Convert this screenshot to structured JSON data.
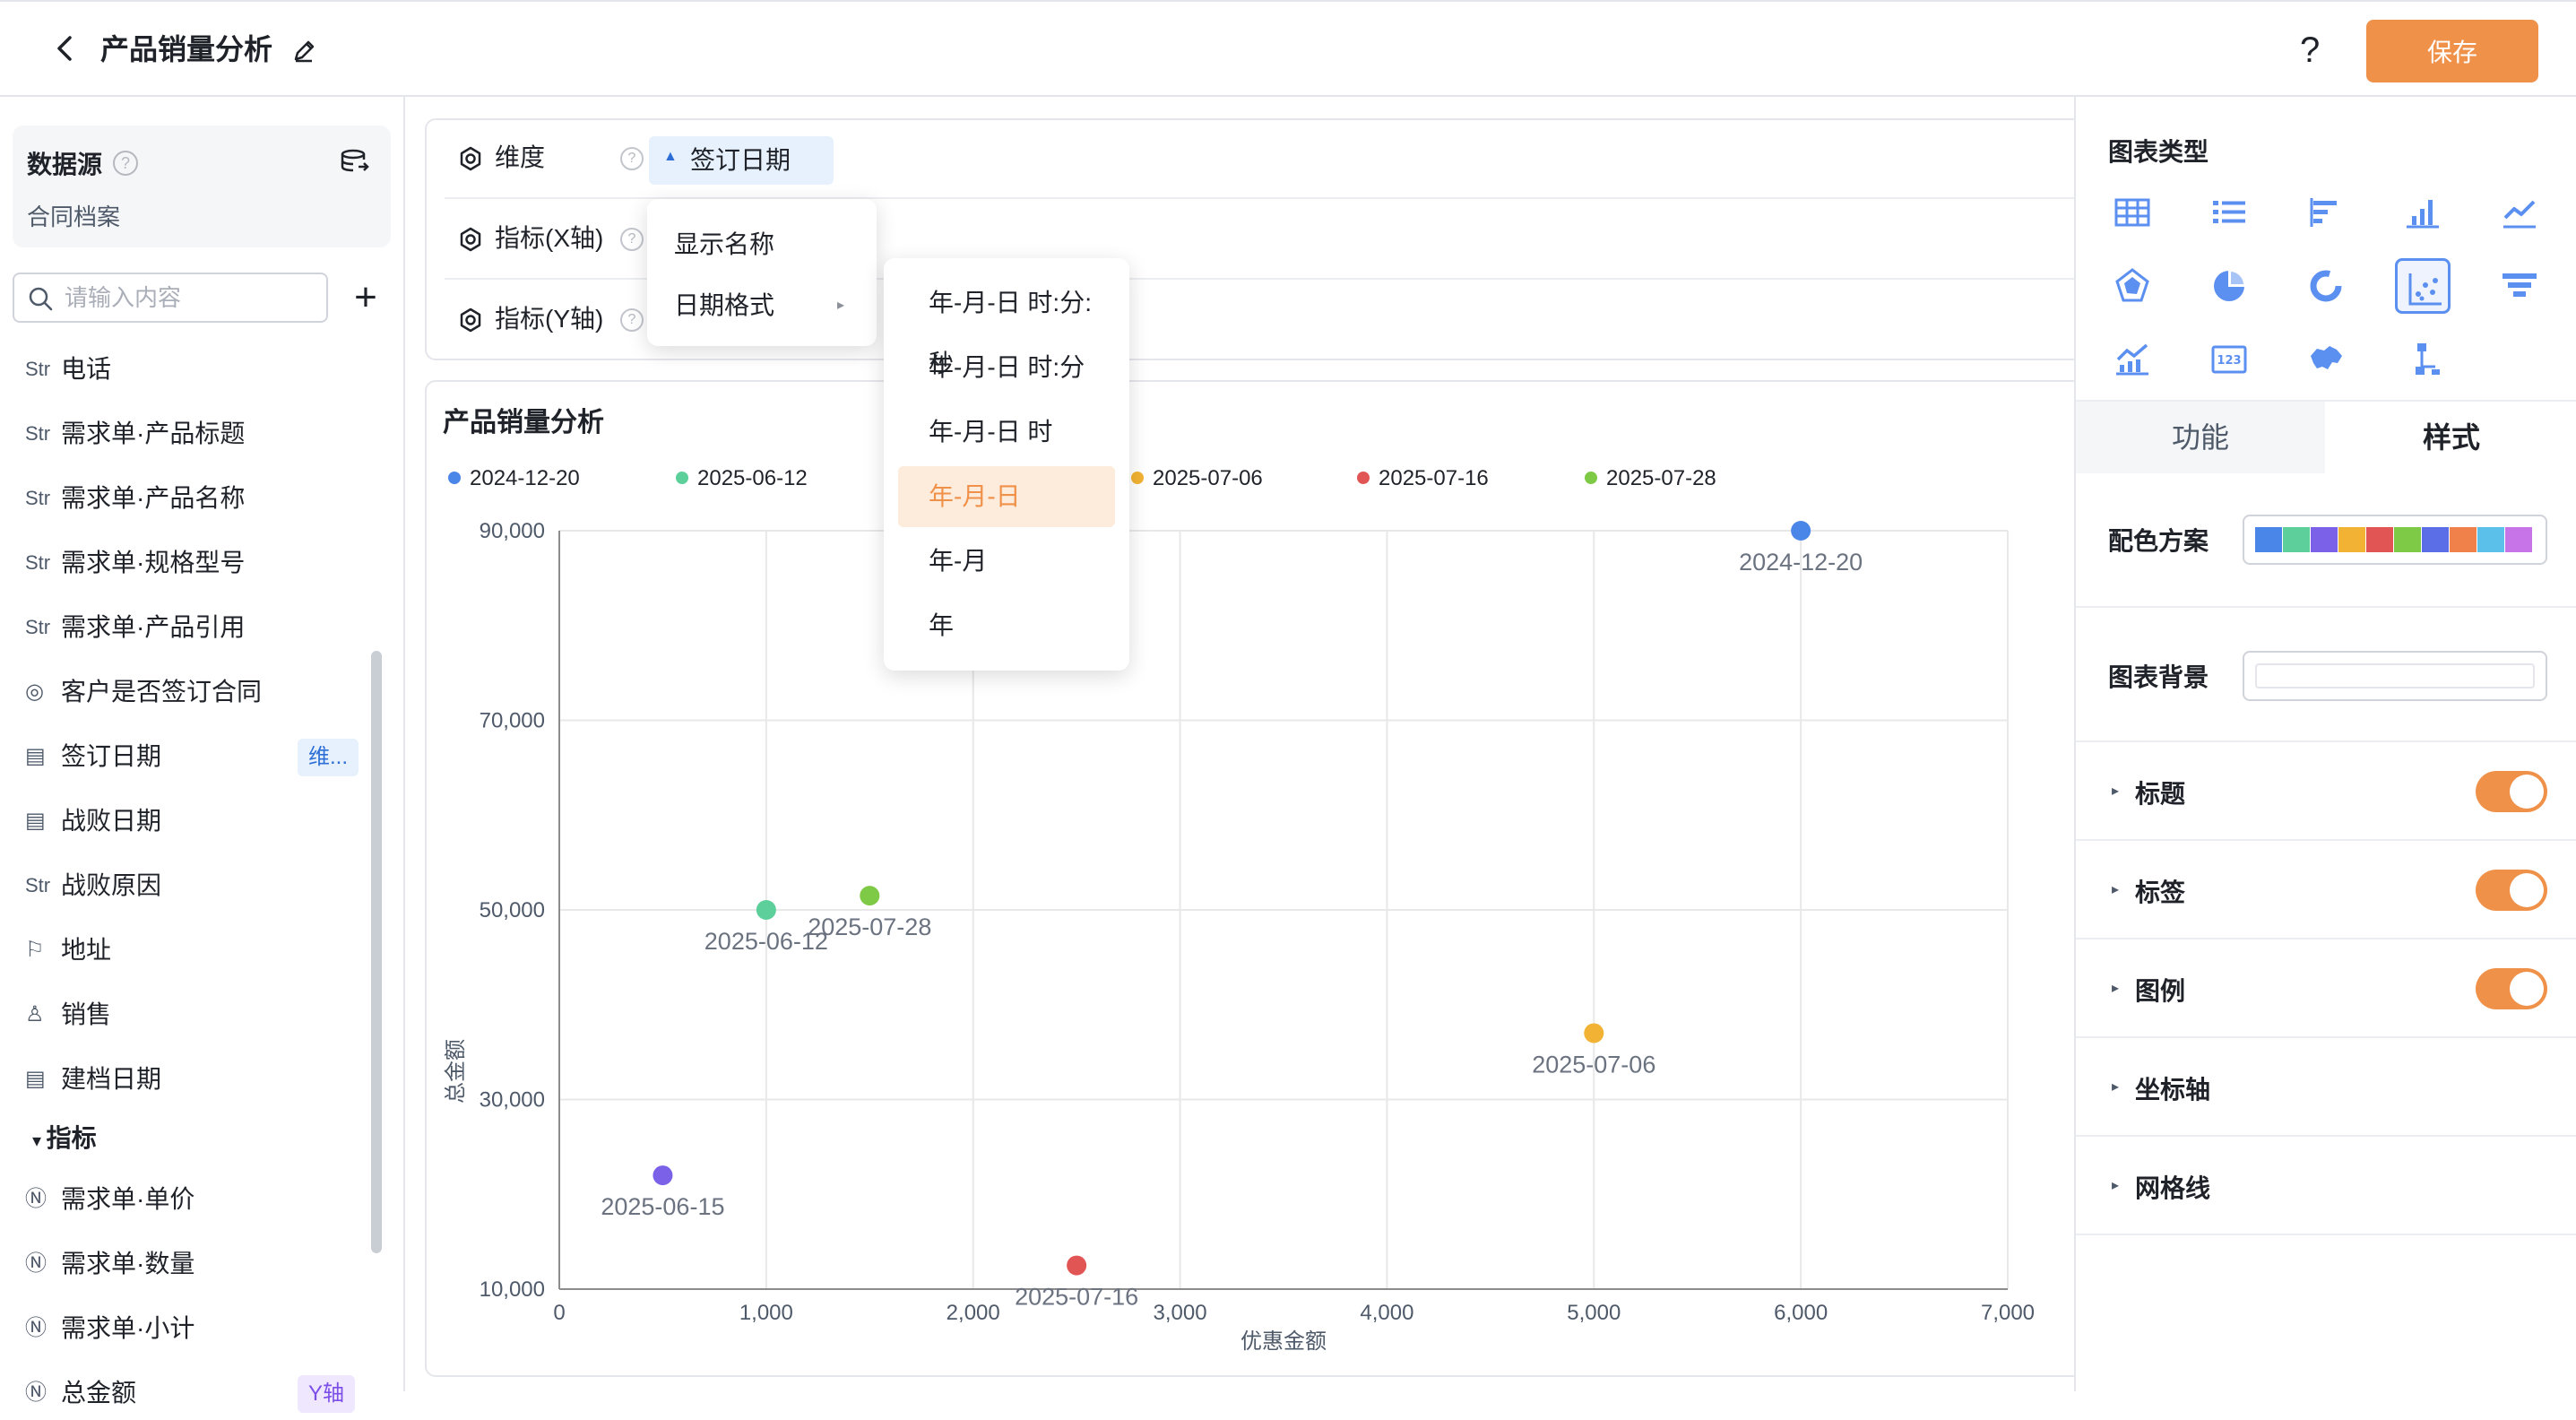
{
  "header": {
    "title": "产品销量分析",
    "help_label": "?",
    "save_label": "保存"
  },
  "datasource": {
    "label": "数据源",
    "help": "?",
    "name": "合同档案"
  },
  "search": {
    "placeholder": "请输入内容",
    "add_label": "+"
  },
  "fields": [
    {
      "type": "Str",
      "label": "电话"
    },
    {
      "type": "Str",
      "label": "需求单·产品标题"
    },
    {
      "type": "Str",
      "label": "需求单·产品名称"
    },
    {
      "type": "Str",
      "label": "需求单·规格型号"
    },
    {
      "type": "Str",
      "label": "需求单·产品引用"
    },
    {
      "type": "radio",
      "label": "客户是否签订合同"
    },
    {
      "type": "date",
      "label": "签订日期",
      "badge": "维..."
    },
    {
      "type": "date",
      "label": "战败日期"
    },
    {
      "type": "Str",
      "label": "战败原因"
    },
    {
      "type": "address",
      "label": "地址"
    },
    {
      "type": "user",
      "label": "销售"
    },
    {
      "type": "date",
      "label": "建档日期"
    }
  ],
  "metrics_group": {
    "label": "指标"
  },
  "metrics": [
    {
      "type": "N",
      "label": "需求单·单价"
    },
    {
      "type": "N",
      "label": "需求单·数量"
    },
    {
      "type": "N",
      "label": "需求单·小计"
    },
    {
      "type": "N",
      "label": "总金额",
      "badge": "Y轴"
    }
  ],
  "config": {
    "dimension": {
      "label": "维度",
      "help": "?",
      "chip": "签订日期"
    },
    "x_axis": {
      "label": "指标(X轴)",
      "help": "?"
    },
    "y_axis": {
      "label": "指标(Y轴)",
      "help": "?"
    }
  },
  "menu": {
    "items": [
      {
        "label": "显示名称"
      },
      {
        "label": "日期格式"
      }
    ],
    "date_formats": [
      {
        "label": "年-月-日 时:分:秒"
      },
      {
        "label": "年-月-日 时:分"
      },
      {
        "label": "年-月-日 时"
      },
      {
        "label": "年-月-日",
        "active": true
      },
      {
        "label": "年-月"
      },
      {
        "label": "年"
      }
    ]
  },
  "chart_data": {
    "type": "scatter",
    "title": "产品销量分析",
    "xlabel": "优惠金额",
    "ylabel": "总金额",
    "xlim": [
      0,
      7000
    ],
    "ylim": [
      10000,
      90000
    ],
    "xticks": [
      "0",
      "1,000",
      "2,000",
      "3,000",
      "4,000",
      "5,000",
      "6,000",
      "7,000"
    ],
    "yticks": [
      "10,000",
      "30,000",
      "50,000",
      "70,000",
      "90,000"
    ],
    "grid": true,
    "legend_position": "top-left",
    "series": [
      {
        "name": "2024-12-20",
        "color": "#4a86e8",
        "points": [
          {
            "x": 6000,
            "y": 90000
          }
        ]
      },
      {
        "name": "2025-06-12",
        "color": "#5ccf9a",
        "points": [
          {
            "x": 1000,
            "y": 50000
          }
        ]
      },
      {
        "name": "2025-06-15",
        "color": "#7b61e8",
        "points": [
          {
            "x": 500,
            "y": 22000
          }
        ]
      },
      {
        "name": "2025-07-06",
        "color": "#f2b233",
        "points": [
          {
            "x": 5000,
            "y": 37000
          }
        ]
      },
      {
        "name": "2025-07-16",
        "color": "#e25555",
        "points": [
          {
            "x": 2500,
            "y": 12500
          }
        ]
      },
      {
        "name": "2025-07-28",
        "color": "#7ec945",
        "points": [
          {
            "x": 1500,
            "y": 51500
          }
        ]
      }
    ]
  },
  "right_panel": {
    "chart_type_label": "图表类型",
    "chart_types": [
      {
        "name": "table-chart-icon"
      },
      {
        "name": "list-chart-icon"
      },
      {
        "name": "horizontal-bar-chart-icon"
      },
      {
        "name": "bar-chart-icon"
      },
      {
        "name": "line-chart-icon"
      },
      {
        "name": "radar-chart-icon"
      },
      {
        "name": "pie-chart-icon"
      },
      {
        "name": "donut-chart-icon"
      },
      {
        "name": "scatter-chart-icon",
        "active": true
      },
      {
        "name": "funnel-chart-icon"
      },
      {
        "name": "combo-chart-icon"
      },
      {
        "name": "number-card-icon"
      },
      {
        "name": "map-chart-icon"
      },
      {
        "name": "tree-chart-icon"
      }
    ],
    "tabs": [
      {
        "label": "功能"
      },
      {
        "label": "样式"
      }
    ],
    "palette_label": "配色方案",
    "palette_colors": [
      "#4a86e8",
      "#5ccf9a",
      "#7b61e8",
      "#f2b233",
      "#e25555",
      "#7ec945",
      "#5b6ee8",
      "#f0814a",
      "#5bc0ea",
      "#c774e8"
    ],
    "background_label": "图表背景",
    "sections": [
      {
        "label": "标题",
        "toggle": true
      },
      {
        "label": "标签",
        "toggle": true
      },
      {
        "label": "图例",
        "toggle": true
      },
      {
        "label": "坐标轴",
        "toggle": false
      },
      {
        "label": "网格线",
        "toggle": false
      }
    ]
  }
}
